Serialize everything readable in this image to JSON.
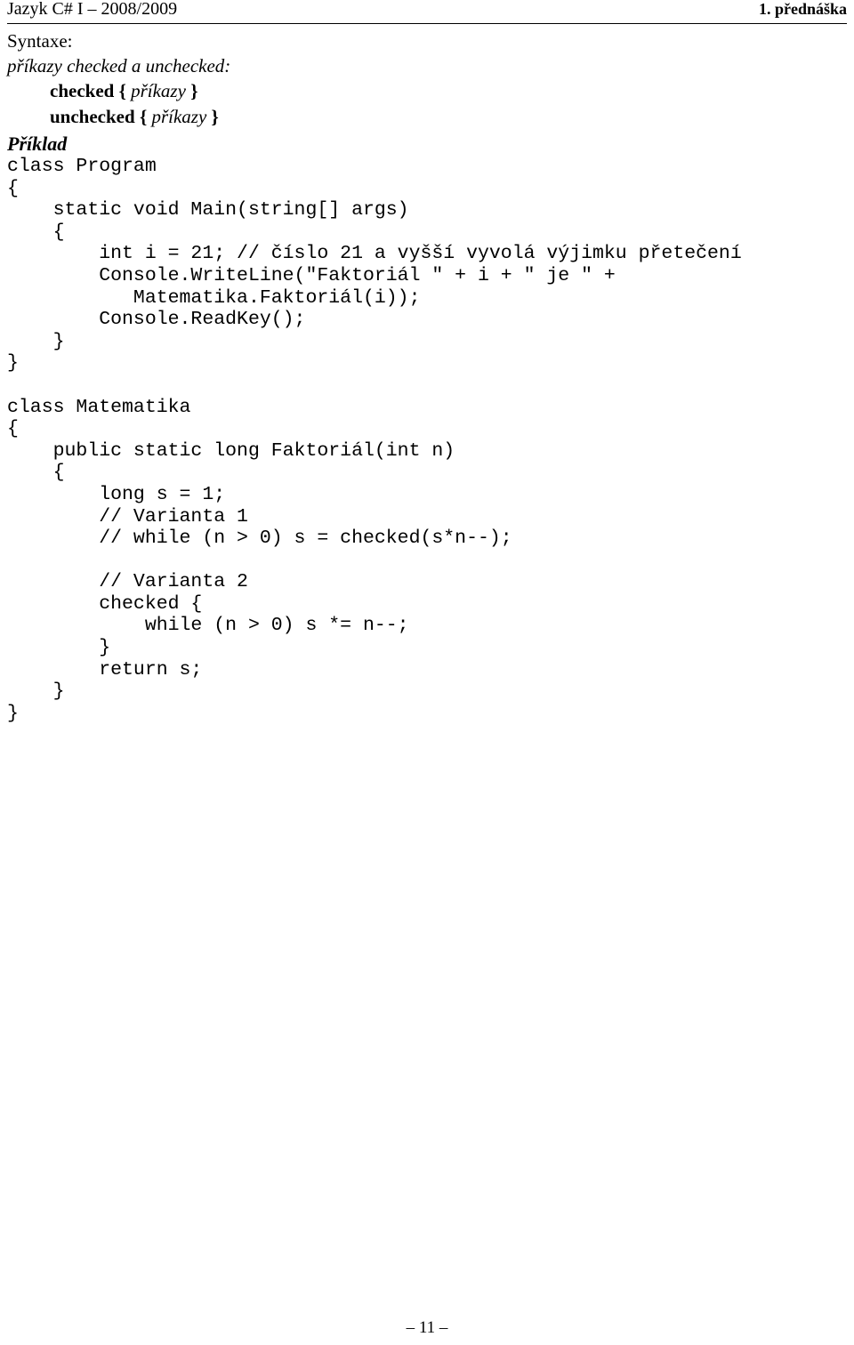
{
  "header": {
    "left": "Jazyk C# I – 2008/2009",
    "right": "1. přednáška"
  },
  "content": {
    "syntaxe_label": "Syntaxe:",
    "syntax_title": "příkazy checked a unchecked:",
    "syntax_lines": [
      {
        "keyword": "checked",
        "open_brace": "{",
        "placeholder": "příkazy",
        "close_brace": "}"
      },
      {
        "keyword": "unchecked",
        "open_brace": "{",
        "placeholder": "příkazy",
        "close_brace": "}"
      }
    ],
    "example_label": "Příklad",
    "code": "class Program\n{\n    static void Main(string[] args)\n    {\n        int i = 21; // číslo 21 a vyšší vyvolá výjimku přetečení\n        Console.WriteLine(\"Faktoriál \" + i + \" je \" +\n           Matematika.Faktoriál(i));\n        Console.ReadKey();\n    }\n}\n\nclass Matematika\n{\n    public static long Faktoriál(int n)\n    {\n        long s = 1;\n        // Varianta 1\n        // while (n > 0) s = checked(s*n--);\n\n        // Varianta 2\n        checked {\n            while (n > 0) s *= n--;\n        }\n        return s;\n    }\n}"
  },
  "footer": {
    "page_number": "– 11 –"
  },
  "colors": {
    "text": "#000000",
    "background": "#ffffff",
    "rule": "#000000"
  }
}
